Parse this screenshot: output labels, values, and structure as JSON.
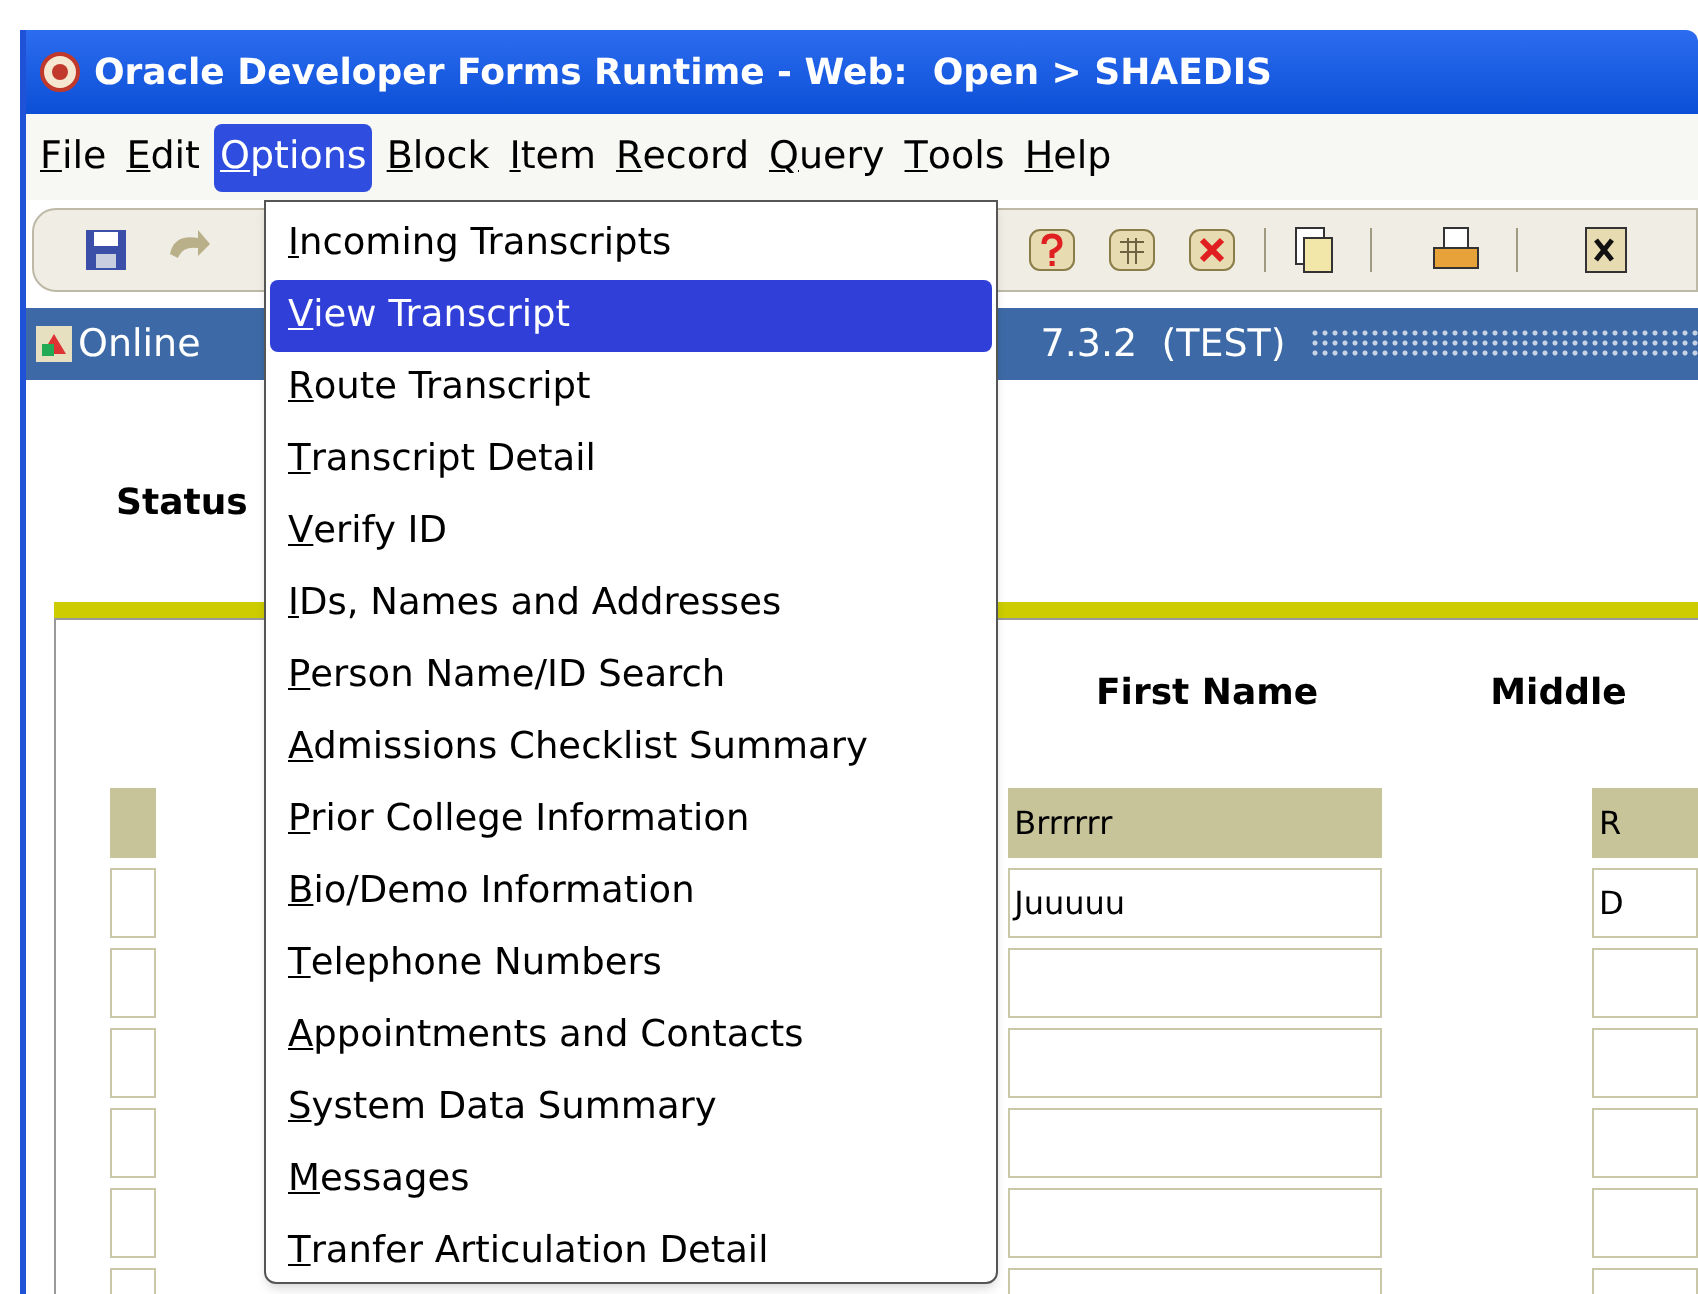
{
  "window": {
    "title": "Oracle Developer Forms Runtime - Web:  Open > SHAEDIS"
  },
  "menubar": [
    {
      "label": "File",
      "selected": false
    },
    {
      "label": "Edit",
      "selected": false
    },
    {
      "label": "Options",
      "selected": true
    },
    {
      "label": "Block",
      "selected": false
    },
    {
      "label": "Item",
      "selected": false
    },
    {
      "label": "Record",
      "selected": false
    },
    {
      "label": "Query",
      "selected": false
    },
    {
      "label": "Tools",
      "selected": false
    },
    {
      "label": "Help",
      "selected": false
    }
  ],
  "options_menu": {
    "items": [
      {
        "label": "Incoming Transcripts",
        "selected": false
      },
      {
        "label": "View Transcript",
        "selected": true
      },
      {
        "label": "Route Transcript",
        "selected": false
      },
      {
        "label": "Transcript Detail",
        "selected": false
      },
      {
        "label": "Verify ID",
        "selected": false
      },
      {
        "label": "IDs, Names and Addresses",
        "selected": false
      },
      {
        "label": "Person Name/ID Search",
        "selected": false
      },
      {
        "label": "Admissions Checklist Summary",
        "selected": false
      },
      {
        "label": "Prior College Information",
        "selected": false
      },
      {
        "label": "Bio/Demo Information",
        "selected": false
      },
      {
        "label": "Telephone Numbers",
        "selected": false
      },
      {
        "label": "Appointments and Contacts",
        "selected": false
      },
      {
        "label": "System Data Summary",
        "selected": false
      },
      {
        "label": "Messages",
        "selected": false
      },
      {
        "label": "Tranfer Articulation Detail",
        "selected": false
      }
    ]
  },
  "form_header": {
    "left": "Online",
    "right": "7.3.2  (TEST)"
  },
  "status_label": "Status",
  "columns": [
    {
      "label": "First Name"
    },
    {
      "label": "Middle"
    }
  ],
  "rows": [
    {
      "selected": true,
      "first_name": "Brrrrrr",
      "middle": "R"
    },
    {
      "selected": false,
      "first_name": "Juuuuu",
      "middle": "D"
    },
    {
      "selected": false
    },
    {
      "selected": false
    },
    {
      "selected": false
    },
    {
      "selected": false
    },
    {
      "selected": false
    }
  ]
}
